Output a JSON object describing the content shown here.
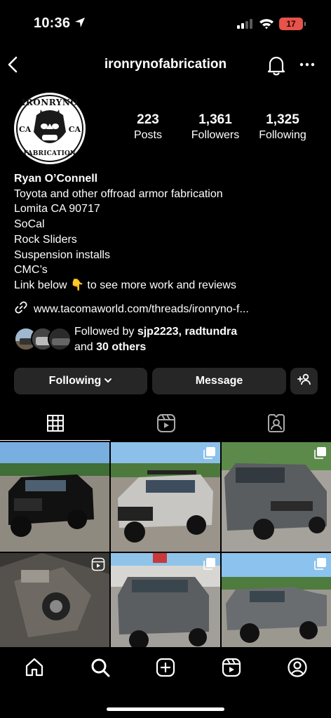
{
  "status": {
    "time": "10:36",
    "battery": "17"
  },
  "header": {
    "username": "ironrynofabrication"
  },
  "stats": [
    {
      "value": "223",
      "label": "Posts"
    },
    {
      "value": "1,361",
      "label": "Followers"
    },
    {
      "value": "1,325",
      "label": "Following"
    }
  ],
  "bio": {
    "name": "Ryan O’Connell",
    "lines": [
      "Toyota and other offroad armor fabrication",
      "Lomita CA 90717",
      "SoCal",
      "Rock Sliders",
      "Suspension installs",
      "CMC’s",
      "Link below 👇 to see more work and reviews"
    ],
    "link": "www.tacomaworld.com/threads/ironryno-f..."
  },
  "followed_by": {
    "prefix": "Followed by ",
    "user1": "sjp2223",
    "sep": ", ",
    "user2": "radtundra",
    "and": "and ",
    "others": "30 others"
  },
  "buttons": {
    "following": "Following",
    "message": "Message"
  },
  "logo": {
    "top_text": "IRONRYNO",
    "bottom_text": "FABRICATION",
    "left": "CA",
    "right": "CA"
  },
  "colors": {
    "background": "#000000",
    "button": "#262626",
    "battery": "#e5534b"
  }
}
